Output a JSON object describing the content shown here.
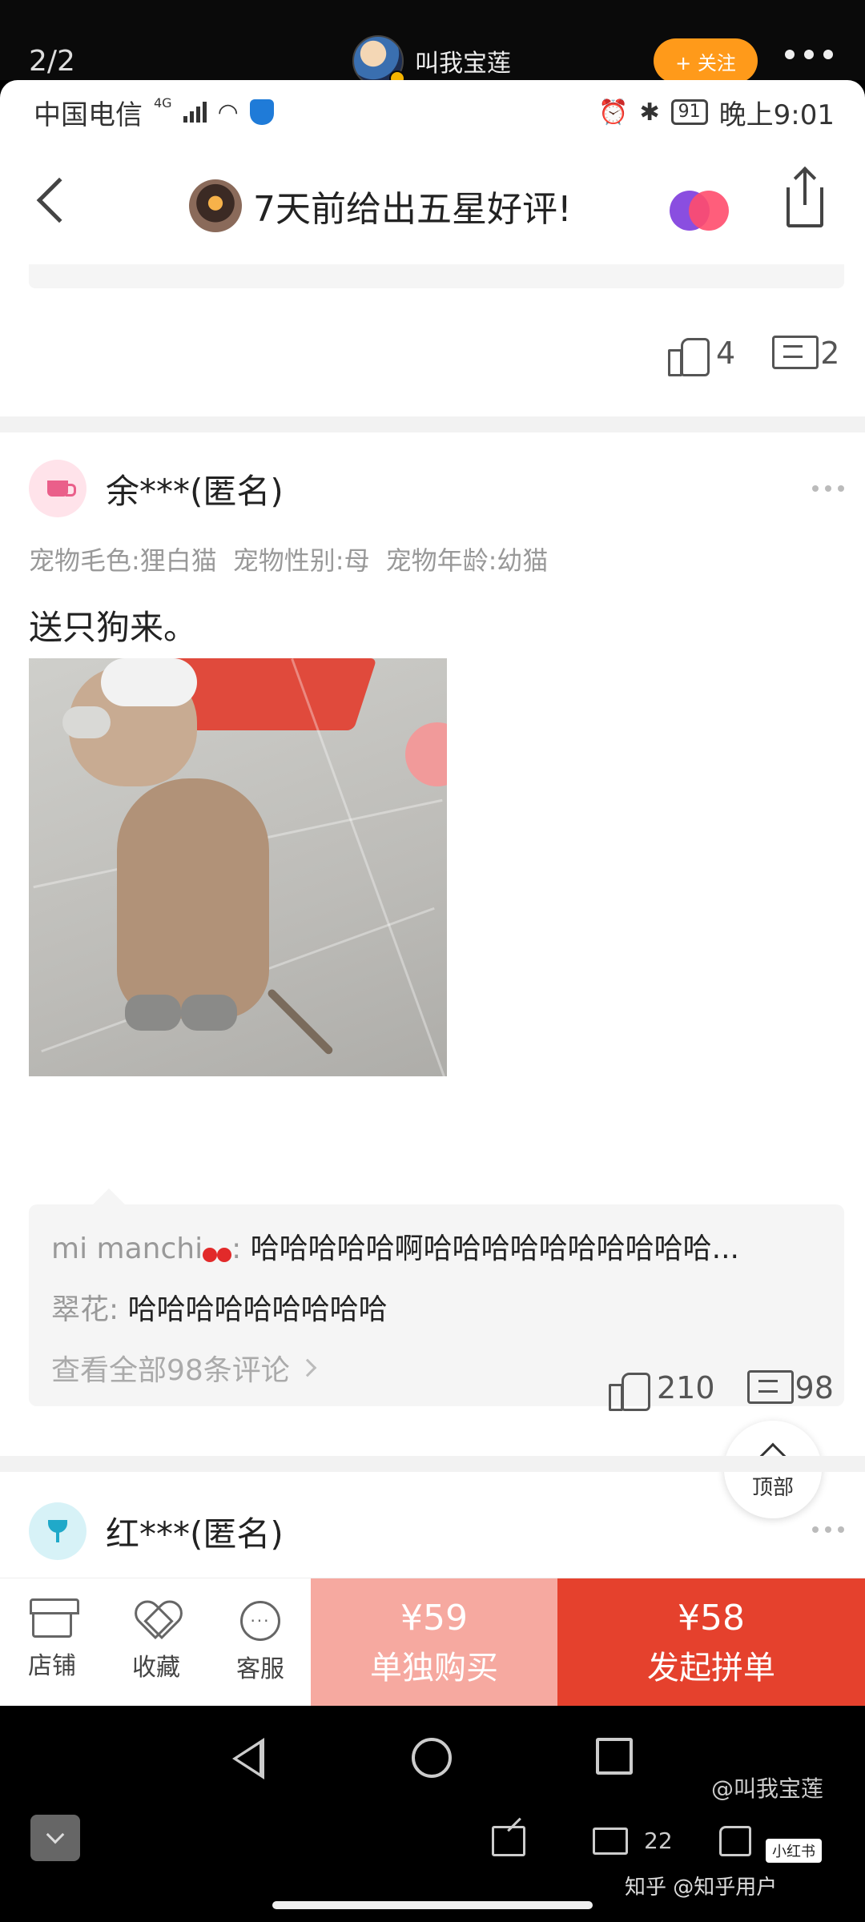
{
  "viewer": {
    "counter": "2/2",
    "author": "叫我宝莲",
    "follow_label": "+ 关注"
  },
  "status_bar": {
    "carrier": "中国电信",
    "network": "4G",
    "battery": "91",
    "time": "晚上9:01"
  },
  "nav": {
    "title": "7天前给出五星好评!"
  },
  "previous_review": {
    "likes": "4",
    "comments": "2"
  },
  "review1": {
    "user": "余***(匿名)",
    "sku": [
      "宠物毛色:狸白猫",
      "宠物性别:母",
      "宠物年龄:幼猫"
    ],
    "text": "送只狗来。",
    "comments": [
      {
        "name": "mi manchi",
        "sep": ":",
        "text": "哈哈哈哈哈啊哈哈哈哈哈哈哈哈哈哈..."
      },
      {
        "name": "翠花",
        "sep": ":",
        "text": "哈哈哈哈哈哈哈哈哈"
      }
    ],
    "view_all": "查看全部98条评论",
    "likes": "210",
    "comment_count": "98"
  },
  "review2": {
    "user": "红***(匿名)"
  },
  "back_to_top": "顶部",
  "buy_bar": {
    "shop": "店铺",
    "favorite": "收藏",
    "service": "客服",
    "single_price": "¥59",
    "single_label": "单独购买",
    "group_price": "¥58",
    "group_label": "发起拼单"
  },
  "watermarks": {
    "weibo": "@叫我宝莲",
    "zhihu": "知乎 @知乎用户",
    "tag": "小红书"
  },
  "viewer_bottom": {
    "comment_count": "22"
  },
  "colors": {
    "accent_orange": "#ff9a1a",
    "buy_group": "#e5412d",
    "buy_single": "#f6a9a0"
  }
}
